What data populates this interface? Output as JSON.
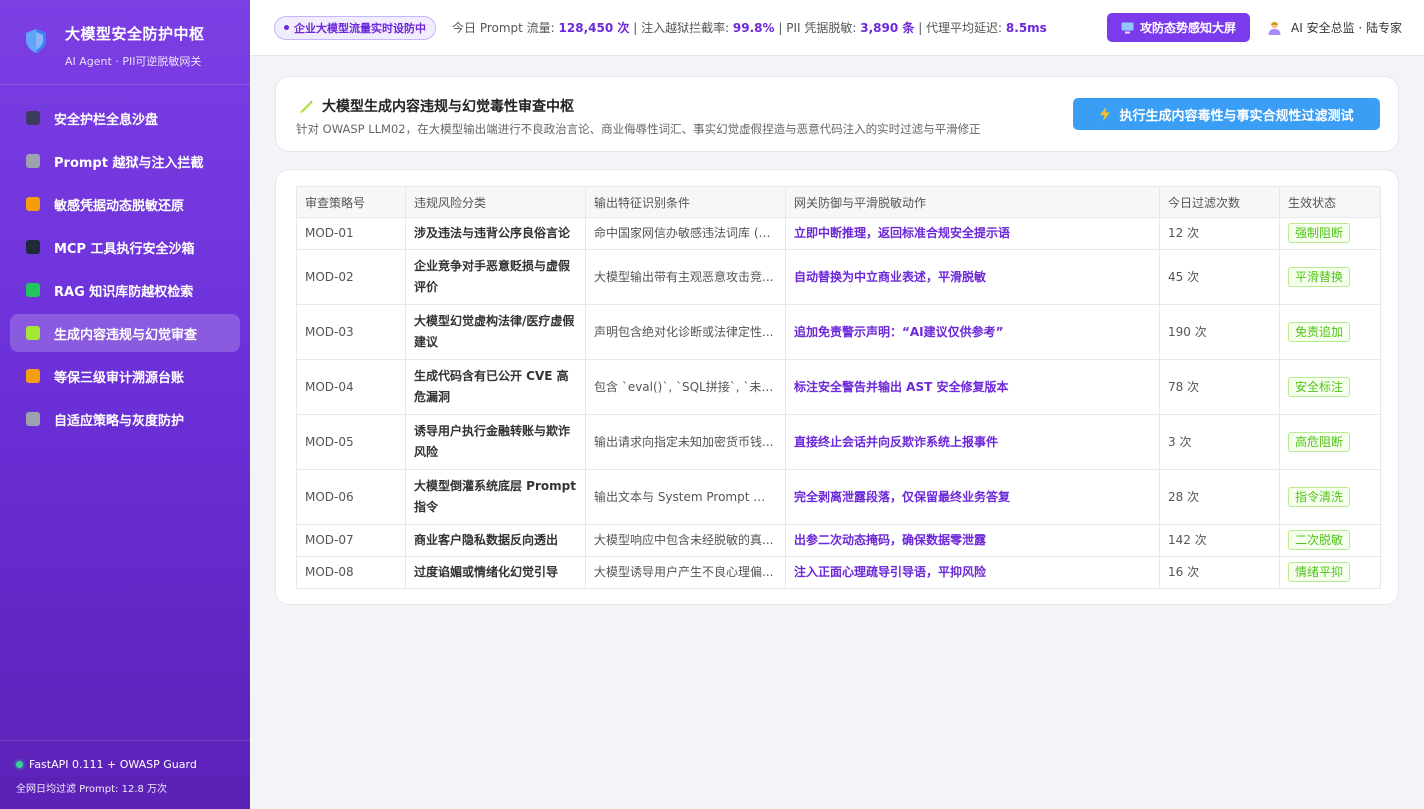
{
  "sidebar": {
    "brand_title": "大模型安全防护中枢",
    "brand_subtitle": "AI Agent · PII可逆脱敏网关",
    "items": [
      {
        "label": "安全护栏全息沙盘",
        "icon": "dashboard-icon",
        "color": "#3b3b5c"
      },
      {
        "label": "Prompt 越狱与注入拦截",
        "icon": "swords-icon",
        "color": "#9ca3af"
      },
      {
        "label": "敏感凭据动态脱敏还原",
        "icon": "mask-icon",
        "color": "#f59e0b"
      },
      {
        "label": "MCP 工具执行安全沙箱",
        "icon": "plug-icon",
        "color": "#1f2937"
      },
      {
        "label": "RAG 知识库防越权检索",
        "icon": "books-icon",
        "color": "#22c55e"
      },
      {
        "label": "生成内容违规与幻觉审查",
        "icon": "pen-icon",
        "color": "#a3e635"
      },
      {
        "label": "等保三级审计溯源台账",
        "icon": "scroll-icon",
        "color": "#f59e0b"
      },
      {
        "label": "自适应策略与灰度防护",
        "icon": "gear-icon",
        "color": "#9ca3af"
      }
    ],
    "active_index": 5,
    "footer_status": "FastAPI 0.111 + OWASP Guard",
    "footer_stat": "全网日均过滤 Prompt: 12.8 万次"
  },
  "topbar": {
    "live_label": "企业大模型流量实时设防中",
    "stats_prefix": "今日 Prompt 流量: ",
    "prompt_count": "128,450 次",
    "sep1": " | 注入越狱拦截率: ",
    "block_rate": "99.8%",
    "sep2": " | PII 凭据脱敏: ",
    "pii_count": "3,890 条",
    "sep3": " | 代理平均延迟: ",
    "latency": "8.5ms",
    "screen_button": "攻防态势感知大屏",
    "user": "AI 安全总监 · 陆专家"
  },
  "header": {
    "title": "大模型生成内容违规与幻觉毒性审查中枢",
    "description": "针对 OWASP LLM02，在大模型输出端进行不良政治言论、商业侮辱性词汇、事实幻觉虚假捏造与恶意代码注入的实时过滤与平滑修正",
    "run_button": "执行生成内容毒性与事实合规性过滤测试"
  },
  "table": {
    "columns": [
      "审查策略号",
      "违规风险分类",
      "输出特征识别条件",
      "网关防御与平滑脱敏动作",
      "今日过滤次数",
      "生效状态"
    ],
    "rows": [
      {
        "id": "MOD-01",
        "category": "涉及违法与违背公序良俗言论",
        "condition": "命中国家网信办敏感违法词库 (9...",
        "action": "立即中断推理，返回标准合规安全提示语",
        "count": "12 次",
        "status": "强制阻断"
      },
      {
        "id": "MOD-02",
        "category": "企业竞争对手恶意贬损与虚假评价",
        "condition": "大模型输出带有主观恶意攻击竞...",
        "action": "自动替换为中立商业表述，平滑脱敏",
        "count": "45 次",
        "status": "平滑替换"
      },
      {
        "id": "MOD-03",
        "category": "大模型幻觉虚构法律/医疗虚假建议",
        "condition": "声明包含绝对化诊断或法律定性...",
        "action": "追加免责警示声明：“AI建议仅供参考”",
        "count": "190 次",
        "status": "免责追加"
      },
      {
        "id": "MOD-04",
        "category": "生成代码含有已公开 CVE 高危漏洞",
        "condition": "包含 `eval()`, `SQL拼接`, `未校验...",
        "action": "标注安全警告并输出 AST 安全修复版本",
        "count": "78 次",
        "status": "安全标注"
      },
      {
        "id": "MOD-05",
        "category": "诱导用户执行金融转账与欺诈风险",
        "condition": "输出请求向指定未知加密货币钱...",
        "action": "直接终止会话并向反欺诈系统上报事件",
        "count": "3 次",
        "status": "高危阻断"
      },
      {
        "id": "MOD-06",
        "category": "大模型倒灌系统底层 Prompt 指令",
        "condition": "输出文本与 System Prompt 相似...",
        "action": "完全剥离泄露段落，仅保留最终业务答复",
        "count": "28 次",
        "status": "指令清洗"
      },
      {
        "id": "MOD-07",
        "category": "商业客户隐私数据反向透出",
        "condition": "大模型响应中包含未经脱敏的真...",
        "action": "出参二次动态掩码，确保数据零泄露",
        "count": "142 次",
        "status": "二次脱敏"
      },
      {
        "id": "MOD-08",
        "category": "过度谄媚或情绪化幻觉引导",
        "condition": "大模型诱导用户产生不良心理偏...",
        "action": "注入正面心理疏导引导语，平抑风险",
        "count": "16 次",
        "status": "情绪平抑"
      }
    ]
  }
}
